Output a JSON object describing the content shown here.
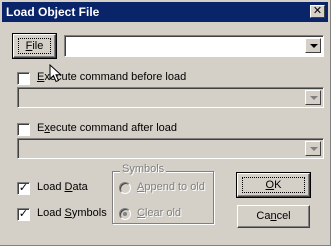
{
  "window": {
    "title": "Load Object File",
    "close_glyph": "✕"
  },
  "file_row": {
    "button": {
      "pre": "",
      "accel": "F",
      "post": "ile"
    },
    "combo_value": ""
  },
  "before_load": {
    "checked": false,
    "label": {
      "pre": "",
      "accel": "E",
      "post": "xecute command before load"
    },
    "combo_value": ""
  },
  "after_load": {
    "checked": false,
    "label": {
      "pre": "E",
      "accel": "x",
      "post": "ecute command after load"
    },
    "combo_value": ""
  },
  "load_data": {
    "checked": true,
    "check_glyph": "✓",
    "label": {
      "pre": "Load ",
      "accel": "D",
      "post": "ata"
    }
  },
  "load_symbols": {
    "checked": true,
    "check_glyph": "✓",
    "label": {
      "pre": "Load ",
      "accel": "S",
      "post": "ymbols"
    }
  },
  "symbols_group": {
    "title": "Symbols",
    "append": {
      "pre": "",
      "accel": "A",
      "post": "ppend to old",
      "selected": false
    },
    "clear": {
      "pre": "",
      "accel": "C",
      "post": "lear old",
      "selected": true
    }
  },
  "buttons": {
    "ok": {
      "pre": "",
      "accel": "O",
      "post": "K"
    },
    "cancel": {
      "pre": "Ca",
      "accel": "n",
      "post": "cel"
    }
  }
}
